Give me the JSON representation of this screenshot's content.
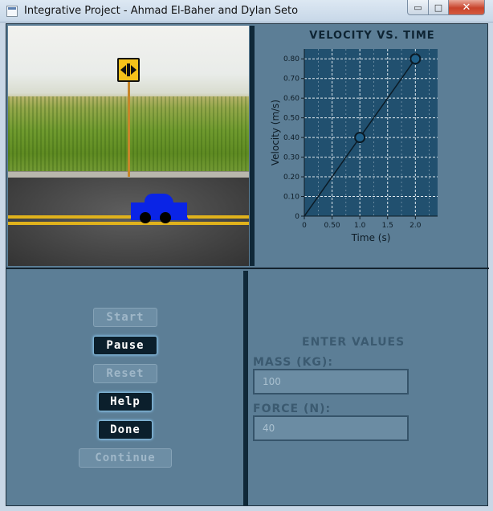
{
  "window": {
    "title": "Integrative Project - Ahmad El-Baher and Dylan Seto",
    "minimize_glyph": "▭",
    "maximize_glyph": "□",
    "close_glyph": "✕"
  },
  "controls": {
    "start": "Start",
    "pause": "Pause",
    "reset": "Reset",
    "help": "Help",
    "done": "Done",
    "continue": "Continue"
  },
  "inputs": {
    "heading": "ENTER VALUES",
    "mass_label": "MASS (KG):",
    "mass_value": "100",
    "force_label": "FORCE (N):",
    "force_value": "40"
  },
  "colors": {
    "panel": "#5c7e96",
    "plot_bg": "#21506f",
    "car": "#0a24e6",
    "sign": "#f5c21a"
  },
  "icons": {
    "sign": "double-arrow-sign-icon",
    "car": "car-icon"
  },
  "chart_data": {
    "type": "line",
    "title": "VELOCITY VS. TIME",
    "xlabel": "Time (s)",
    "ylabel": "Velocity (m/s)",
    "xlim": [
      0,
      2.4
    ],
    "ylim": [
      0,
      0.85
    ],
    "xticks": [
      0,
      0.5,
      1.0,
      1.5,
      2.0
    ],
    "xtick_labels": [
      "0",
      "0.50",
      "1.0",
      "1.5",
      "2.0"
    ],
    "yticks": [
      0,
      0.1,
      0.2,
      0.3,
      0.4,
      0.5,
      0.6,
      0.7,
      0.8
    ],
    "ytick_labels": [
      "0",
      "0.10",
      "0.20",
      "0.30",
      "0.40",
      "0.50",
      "0.60",
      "0.70",
      "0.80"
    ],
    "grid": true,
    "x": [
      0,
      1,
      2
    ],
    "y": [
      0,
      0.4,
      0.8
    ],
    "markers": [
      false,
      true,
      true
    ]
  }
}
